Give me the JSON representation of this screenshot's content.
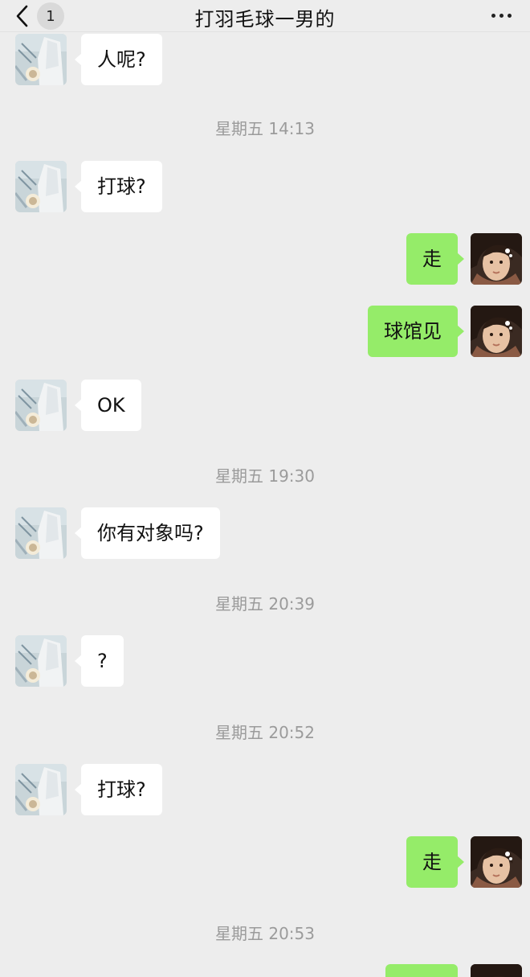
{
  "header": {
    "unread_count": "1",
    "title": "打羽毛球一男的"
  },
  "messages": [
    {
      "side": "in",
      "text": "人呢?"
    },
    {
      "time": "星期五 14:13"
    },
    {
      "side": "in",
      "text": "打球?"
    },
    {
      "side": "out",
      "text": "走"
    },
    {
      "side": "out",
      "text": "球馆见"
    },
    {
      "side": "in",
      "text": "OK"
    },
    {
      "time": "星期五 19:30"
    },
    {
      "side": "in",
      "text": "你有对象吗?"
    },
    {
      "time": "星期五 20:39"
    },
    {
      "side": "in",
      "text": "?"
    },
    {
      "time": "星期五 20:52"
    },
    {
      "side": "in",
      "text": "打球?"
    },
    {
      "side": "out",
      "text": "走"
    },
    {
      "time": "星期五 20:53"
    },
    {
      "side": "out",
      "text": ""
    }
  ],
  "colors": {
    "background": "#ededed",
    "incoming_bubble": "#ffffff",
    "outgoing_bubble": "#95ec69",
    "timestamp_text": "#9b9b9b"
  }
}
